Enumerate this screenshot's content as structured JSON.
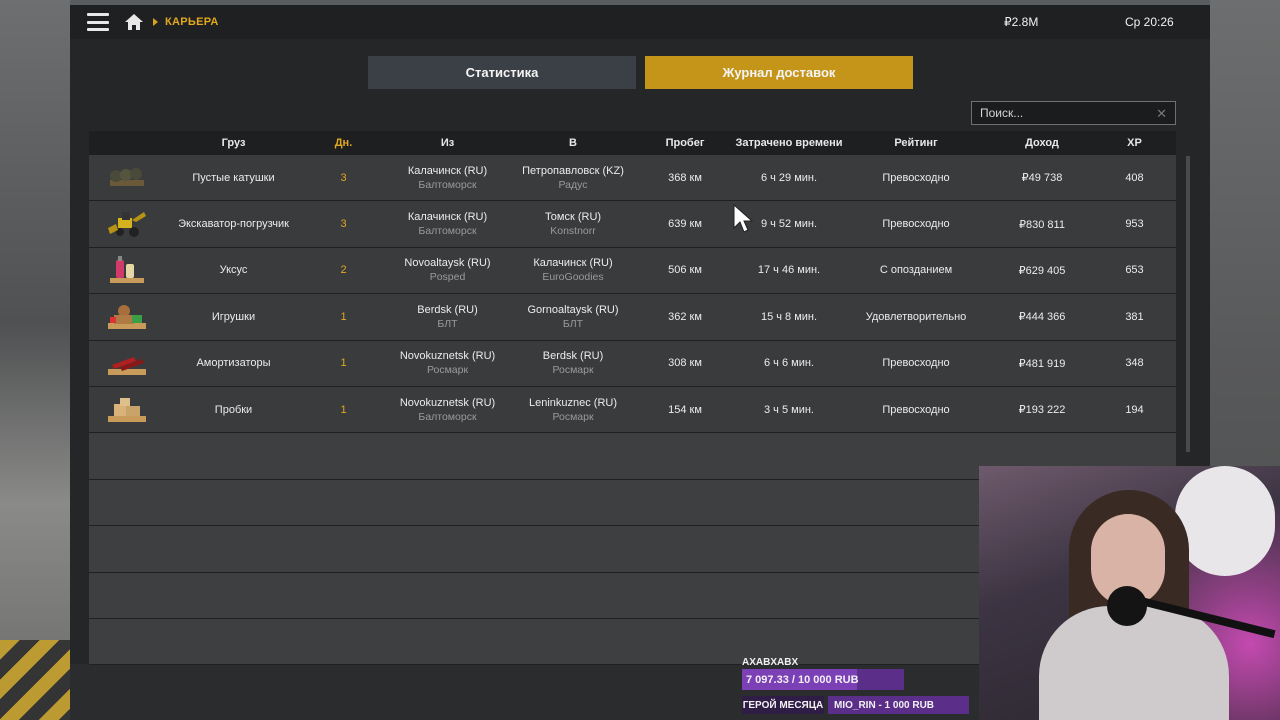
{
  "topbar": {
    "breadcrumb": "КАРЬЕРА",
    "money": "₽2.8M",
    "clock": "Ср 20:26"
  },
  "tabs": [
    {
      "label": "Статистика",
      "active": false
    },
    {
      "label": "Журнал доставок",
      "active": true
    }
  ],
  "search": {
    "placeholder": "Поиск...",
    "clear_icon": "close-icon"
  },
  "columns": {
    "cargo": "Груз",
    "days": "Дн.",
    "from": "Из",
    "to": "В",
    "distance": "Пробег",
    "time": "Затрачено времени",
    "rating": "Рейтинг",
    "income": "Доход",
    "xp": "XP"
  },
  "rows": [
    {
      "icon": "coils-icon",
      "cargo": "Пустые катушки",
      "days": "3",
      "from_city": "Калачинск (RU)",
      "from_company": "Балтоморск",
      "to_city": "Петропавловск (KZ)",
      "to_company": "Радус",
      "distance": "368 км",
      "time": "6 ч 29 мин.",
      "rating": "Превосходно",
      "income": "₽49 738",
      "xp": "408"
    },
    {
      "icon": "backhoe-loader-icon",
      "cargo": "Экскаватор-погрузчик",
      "days": "3",
      "from_city": "Калачинск (RU)",
      "from_company": "Балтоморск",
      "to_city": "Томск (RU)",
      "to_company": "Konstnorr",
      "distance": "639 км",
      "time": "9 ч 52 мин.",
      "rating": "Превосходно",
      "income": "₽830 811",
      "xp": "953"
    },
    {
      "icon": "vinegar-bottles-icon",
      "cargo": "Уксус",
      "days": "2",
      "from_city": "Novoaltaysk (RU)",
      "from_company": "Posped",
      "to_city": "Калачинск (RU)",
      "to_company": "EuroGoodies",
      "distance": "506 км",
      "time": "17 ч 46 мин.",
      "rating": "С опозданием",
      "income": "₽629 405",
      "xp": "653"
    },
    {
      "icon": "toys-pallet-icon",
      "cargo": "Игрушки",
      "days": "1",
      "from_city": "Berdsk (RU)",
      "from_company": "БЛТ",
      "to_city": "Gornoaltaysk (RU)",
      "to_company": "БЛТ",
      "distance": "362 км",
      "time": "15 ч 8 мин.",
      "rating": "Удовлетворительно",
      "income": "₽444 366",
      "xp": "381"
    },
    {
      "icon": "shock-absorbers-icon",
      "cargo": "Амортизаторы",
      "days": "1",
      "from_city": "Novokuznetsk (RU)",
      "from_company": "Росмарк",
      "to_city": "Berdsk (RU)",
      "to_company": "Росмарк",
      "distance": "308 км",
      "time": "6 ч 6 мин.",
      "rating": "Превосходно",
      "income": "₽481 919",
      "xp": "348"
    },
    {
      "icon": "corks-pallet-icon",
      "cargo": "Пробки",
      "days": "1",
      "from_city": "Novokuznetsk (RU)",
      "from_company": "Балтоморск",
      "to_city": "Leninkuznec (RU)",
      "to_company": "Росмарк",
      "distance": "154 км",
      "time": "3 ч 5 мин.",
      "rating": "Превосходно",
      "income": "₽193 222",
      "xp": "194"
    }
  ],
  "empty_rows": 5,
  "overlay": {
    "donor": "AXABXABX",
    "goal_text": "7 097.33 / 10 000 RUB",
    "goal_progress": 0.71,
    "hero_label": "ГЕРОЙ МЕСЯЦА",
    "hero_value": "MIO_RIN - 1 000 RUB"
  },
  "colors": {
    "accent": "#e1a823",
    "active_tab": "#c5951a",
    "inactive_tab": "#3b4046",
    "row_bg": "#3a3b3c",
    "overlay_purple": "#5b2e8a"
  }
}
